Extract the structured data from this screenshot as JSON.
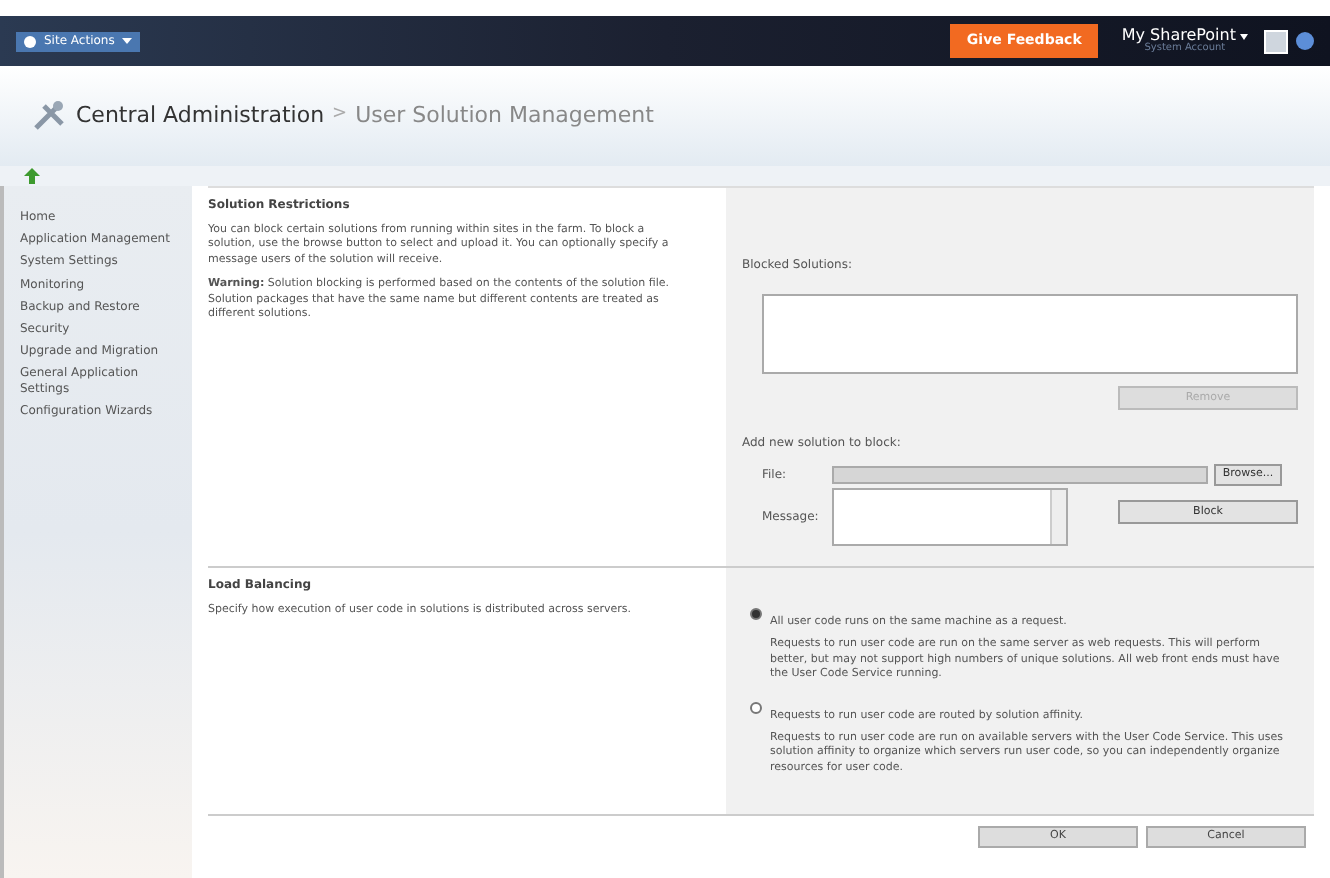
{
  "top_bar": {
    "site_actions": "Site Actions",
    "feedback": "Give Feedback",
    "my_sharepoint": "My SharePoint",
    "account": "System Account"
  },
  "breadcrumb": {
    "site": "Central Administration",
    "separator": ">",
    "page": "User Solution Management"
  },
  "sidebar": {
    "items": [
      {
        "label": "Home"
      },
      {
        "label": "Application Management"
      },
      {
        "label": "System Settings"
      },
      {
        "label": "Monitoring"
      },
      {
        "label": "Backup and Restore"
      },
      {
        "label": "Security"
      },
      {
        "label": "Upgrade and Migration"
      },
      {
        "label": "General Application Settings"
      },
      {
        "label": "Configuration Wizards"
      }
    ]
  },
  "restrictions": {
    "title": "Solution Restrictions",
    "description": "You can block certain solutions from running within sites in the farm. To block a solution, use the browse button to select and upload it. You can optionally specify a message users of the solution will receive.",
    "warning": "**Warning:** Solution blocking is performed based on the contents of the solution file. Solution packages that have the same name but different contents are treated as different solutions.",
    "blocked_label": "Blocked Solutions:",
    "remove_button": "Remove",
    "add_label": "Add new solution to block:",
    "file_label": "File:",
    "browse_button": "Browse...",
    "message_label": "Message:",
    "block_button": "Block"
  },
  "load_balancing": {
    "title": "Load Balancing",
    "description": "Specify how execution of user code in solutions is distributed across servers.",
    "options": [
      {
        "label": "All user code runs on the same machine as a request.",
        "detail": "Requests to run user code are run on the same server as web requests. This will perform better, but may not support high numbers of unique solutions. All web front ends must have the User Code Service running.",
        "selected": true
      },
      {
        "label": "Requests to run user code are routed by solution affinity.",
        "detail": "Requests to run user code are run on available servers with the User Code Service. This uses solution affinity to organize which servers run user code, so you can independently organize resources for user code.",
        "selected": false
      }
    ]
  },
  "buttons": [
    "OK",
    "Cancel"
  ]
}
